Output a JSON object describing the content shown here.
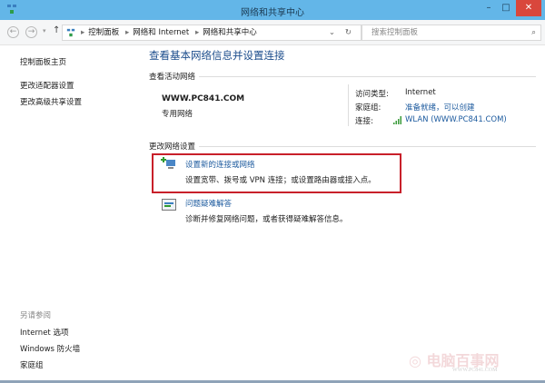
{
  "window": {
    "title": "网络和共享中心",
    "minimize": "–",
    "maximize": "□",
    "close": "✕"
  },
  "nav": {
    "back": "←",
    "forward": "→",
    "recent": "▾",
    "up": "↑",
    "breadcrumb": [
      "控制面板",
      "网络和 Internet",
      "网络和共享中心"
    ],
    "dropdown": "⌄",
    "refresh": "↻",
    "search_placeholder": "搜索控制面板",
    "search_icon": "⌕"
  },
  "sidebar": {
    "home": "控制面板主页",
    "items": [
      "更改适配器设置",
      "更改高级共享设置"
    ],
    "see_also": "另请参阅",
    "see_also_items": [
      "Internet 选项",
      "Windows 防火墙",
      "家庭组"
    ]
  },
  "main": {
    "title": "查看基本网络信息并设置连接",
    "active_section": "查看活动网络",
    "network_name": "WWW.PC841.COM",
    "network_type": "专用网络",
    "access_label": "访问类型:",
    "access_value": "Internet",
    "homegroup_label": "家庭组:",
    "homegroup_value": "准备就绪，可以创建",
    "conn_label": "连接:",
    "conn_value": "WLAN (WWW.PC841.COM)",
    "change_section": "更改网络设置",
    "tasks": [
      {
        "title": "设置新的连接或网络",
        "desc": "设置宽带、拨号或 VPN 连接；或设置路由器或接入点。"
      },
      {
        "title": "问题疑难解答",
        "desc": "诊断并修复网络问题，或者获得疑难解答信息。"
      }
    ]
  },
  "watermark": {
    "text": "电脑百事网",
    "url": "WWW.PC841.COM"
  }
}
